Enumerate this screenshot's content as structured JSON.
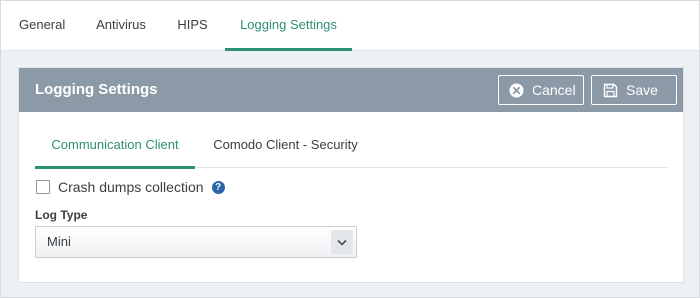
{
  "top_tabs": [
    {
      "label": "General"
    },
    {
      "label": "Antivirus"
    },
    {
      "label": "HIPS"
    },
    {
      "label": "Logging Settings"
    }
  ],
  "panel": {
    "title": "Logging Settings",
    "cancel_label": "Cancel",
    "save_label": "Save"
  },
  "inner_tabs": [
    {
      "label": "Communication Client"
    },
    {
      "label": "Comodo Client - Security"
    }
  ],
  "crash_dumps": {
    "label": "Crash dumps collection",
    "checked": false,
    "help_glyph": "?"
  },
  "log_type": {
    "label": "Log Type",
    "value": "Mini"
  },
  "colors": {
    "accent": "#2e8f77",
    "header": "#8c9aa8",
    "help": "#2a63a8"
  },
  "icons": {
    "cancel": "close-circle-icon",
    "save": "floppy-disk-icon",
    "help": "question-circle-icon",
    "dropdown": "chevron-down-icon"
  }
}
